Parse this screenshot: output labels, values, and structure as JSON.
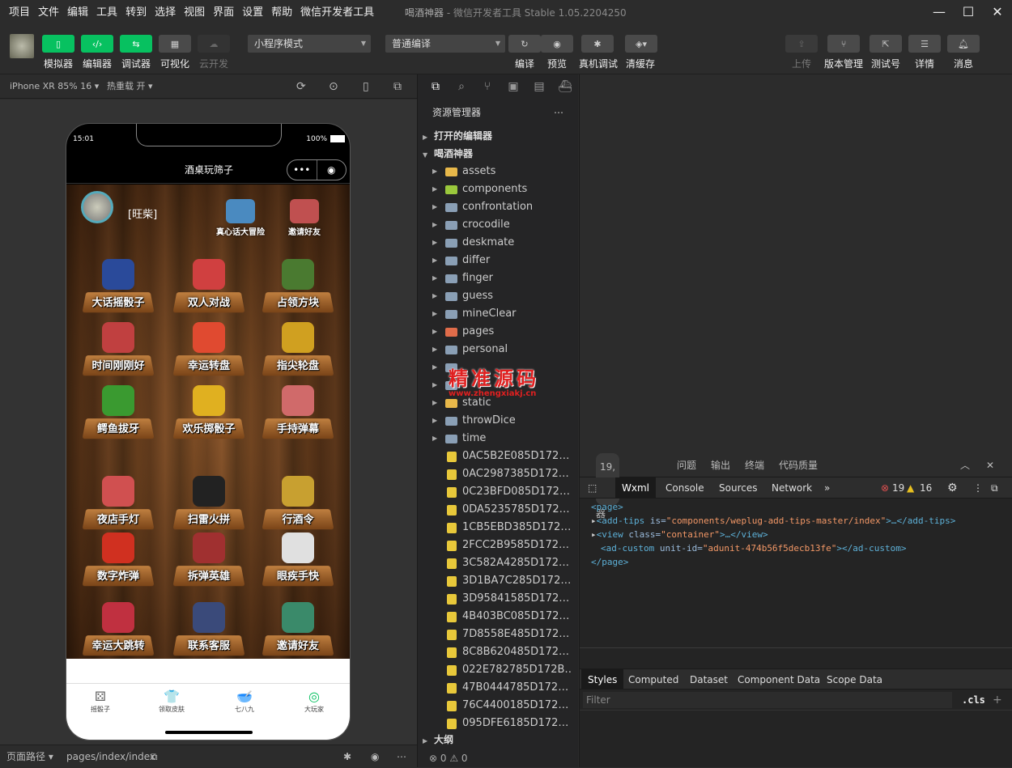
{
  "menu": [
    "项目",
    "文件",
    "编辑",
    "工具",
    "转到",
    "选择",
    "视图",
    "界面",
    "设置",
    "帮助",
    "微信开发者工具"
  ],
  "window_title": {
    "app": "喝酒神器",
    "suffix": "- 微信开发者工具 Stable 1.05.2204250"
  },
  "toolbar": {
    "simulator": "模拟器",
    "editor": "编辑器",
    "debugger": "调试器",
    "visual": "可视化",
    "cloud": "云开发",
    "mode_select": "小程序模式",
    "compile_select": "普通编译",
    "compile": "编译",
    "preview": "预览",
    "remote_debug": "真机调试",
    "clear_cache": "清缓存",
    "upload": "上传",
    "version": "版本管理",
    "test_account": "测试号",
    "details": "详情",
    "messages": "消息"
  },
  "simbar": {
    "device": "iPhone XR 85% 16 ▾",
    "hot_reload": "热重载 开 ▾"
  },
  "phone": {
    "time": "15:01",
    "battery": "100%",
    "nav_title": "酒桌玩筛子",
    "capsule_more": "•••",
    "capsule_close": "◉",
    "username": "[旺柴]",
    "top_left": "真心话大冒险",
    "top_right": "邀请好友",
    "games": [
      {
        "label": "大话摇骰子",
        "color": "#2a4a9a"
      },
      {
        "label": "双人对战",
        "color": "#d04040"
      },
      {
        "label": "占领方块",
        "color": "#4a7a30"
      },
      {
        "label": "时间刚刚好",
        "color": "#c04040"
      },
      {
        "label": "幸运转盘",
        "color": "#e04a30"
      },
      {
        "label": "指尖轮盘",
        "color": "#d0a020"
      },
      {
        "label": "鳄鱼拔牙",
        "color": "#3a9a30"
      },
      {
        "label": "欢乐掷骰子",
        "color": "#e0b020"
      },
      {
        "label": "手持弹幕",
        "color": "#d06a6a"
      },
      {
        "label": "夜店手灯",
        "color": "#d05050"
      },
      {
        "label": "扫雷火拼",
        "color": "#222222"
      },
      {
        "label": "行酒令",
        "color": "#c8a030"
      },
      {
        "label": "数字炸弹",
        "color": "#d03020"
      },
      {
        "label": "拆弹英雄",
        "color": "#a03030"
      },
      {
        "label": "眼疾手快",
        "color": "#e0e0e0"
      },
      {
        "label": "幸运大跳转",
        "color": "#c03040"
      },
      {
        "label": "联系客服",
        "color": "#3a4a7a"
      },
      {
        "label": "邀请好友",
        "color": "#3a8a6a"
      }
    ],
    "tabs": [
      {
        "icon": "⚄",
        "label": "摇骰子"
      },
      {
        "icon": "👕",
        "label": "领取皮肤"
      },
      {
        "icon": "🥣",
        "label": "七八九"
      },
      {
        "icon": "◎",
        "label": "大玩家"
      }
    ]
  },
  "footer": {
    "path_label": "页面路径 ▾",
    "path": "pages/index/index"
  },
  "explorer": {
    "title": "资源管理器",
    "open_editors": "打开的编辑器",
    "project": "喝酒神器",
    "outline": "大纲",
    "status": "⊗ 0 ⚠ 0",
    "folders": [
      {
        "name": "assets",
        "kind": "yfolder"
      },
      {
        "name": "components",
        "kind": "gfolder"
      },
      {
        "name": "confrontation",
        "kind": "folder"
      },
      {
        "name": "crocodile",
        "kind": "folder"
      },
      {
        "name": "deskmate",
        "kind": "folder"
      },
      {
        "name": "differ",
        "kind": "folder"
      },
      {
        "name": "finger",
        "kind": "folder"
      },
      {
        "name": "guess",
        "kind": "folder"
      },
      {
        "name": "mineClear",
        "kind": "folder"
      },
      {
        "name": "pages",
        "kind": "rfolder"
      },
      {
        "name": "personal",
        "kind": "folder"
      },
      {
        "name": "",
        "kind": "folder"
      },
      {
        "name": "",
        "kind": "folder"
      },
      {
        "name": "static",
        "kind": "yfolder"
      },
      {
        "name": "throwDice",
        "kind": "folder"
      },
      {
        "name": "time",
        "kind": "folder"
      }
    ],
    "files": [
      "0AC5B2E085D172BF6C...",
      "0AC2987385D172BF6C...",
      "0C23BFD085D172BF6A...",
      "0DA5235785D172BF6B...",
      "1CB5EBD385D172BF7A...",
      "2FCC2B9585D172BF49...",
      "3C582A4285D172BF5A...",
      "3D1BA7C285D172BF5B...",
      "3D95841585D172BF5B...",
      "4B403BC085D172BF2D...",
      "7D8558E485D172BF1B...",
      "8C8B620485D172BFEA...",
      "022E782785D172BF64...",
      "47B0444785D172BF21...",
      "76C4400185D172BF10...",
      "095DFE6185D172BF6F..."
    ]
  },
  "watermark": {
    "line1": "精准源码",
    "line2": "www.zhengxiakj.cn"
  },
  "debugger": {
    "tab_debugger": "调试器",
    "badge": "19, 16",
    "tab_issues": "问题",
    "tab_output": "输出",
    "tab_terminal": "终端",
    "tab_quality": "代码质量",
    "dev_wxml": "Wxml",
    "dev_console": "Console",
    "dev_sources": "Sources",
    "dev_network": "Network",
    "errors": "19",
    "warnings": "16",
    "dom": {
      "l1": "<page>",
      "l2_tag": "<add-tips",
      "l2_attr": " is=",
      "l2_val": "\"components/weplug-add-tips-master/index\"",
      "l2_end": ">…</add-tips>",
      "l3_tag": "<view",
      "l3_attr": " class=",
      "l3_val": "\"container\"",
      "l3_end": ">…</view>",
      "l4_tag": "<ad-custom",
      "l4_attr": " unit-id=",
      "l4_val": "\"adunit-474b56f5decb13fe\"",
      "l4_end": "></ad-custom>",
      "l5": "</page>"
    },
    "styles": "Styles",
    "computed": "Computed",
    "dataset": "Dataset",
    "component_data": "Component Data",
    "scope_data": "Scope Data",
    "filter_placeholder": "Filter",
    "cls": ".cls"
  }
}
